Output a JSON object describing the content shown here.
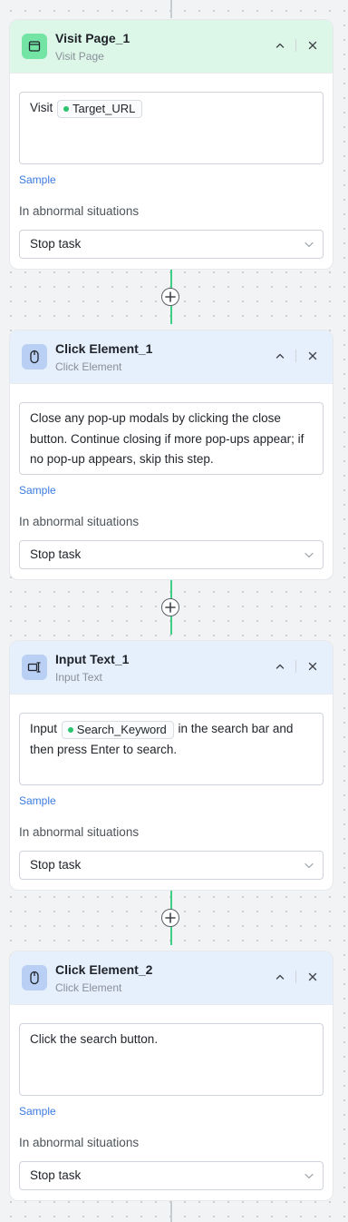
{
  "nodes": [
    {
      "title": "Visit Page_1",
      "subtitle": "Visit Page",
      "icon": "browser-window-icon",
      "header_color": "#dcf7e8",
      "prompt_parts": [
        {
          "type": "text",
          "text": "Visit "
        },
        {
          "type": "var",
          "text": "Target_URL"
        }
      ],
      "sample_label": "Sample",
      "abnormal_label": "In abnormal situations",
      "abnormal_value": "Stop task"
    },
    {
      "title": "Click Element_1",
      "subtitle": "Click Element",
      "icon": "mouse-icon",
      "header_color": "#e6effc",
      "prompt_parts": [
        {
          "type": "text",
          "text": "Close any pop-up modals by clicking the close button. Continue closing if more pop-ups appear; if no pop-up appears, skip this step."
        }
      ],
      "sample_label": "Sample",
      "abnormal_label": "In abnormal situations",
      "abnormal_value": "Stop task"
    },
    {
      "title": "Input Text_1",
      "subtitle": "Input Text",
      "icon": "text-input-icon",
      "header_color": "#e6effc",
      "prompt_parts": [
        {
          "type": "text",
          "text": "Input "
        },
        {
          "type": "var",
          "text": "Search_Keyword"
        },
        {
          "type": "text",
          "text": " in the search bar and then press Enter to search."
        }
      ],
      "sample_label": "Sample",
      "abnormal_label": "In abnormal situations",
      "abnormal_value": "Stop task"
    },
    {
      "title": "Click Element_2",
      "subtitle": "Click Element",
      "icon": "mouse-icon",
      "header_color": "#e6effc",
      "prompt_parts": [
        {
          "type": "text",
          "text": "Click the search button."
        }
      ],
      "sample_label": "Sample",
      "abnormal_label": "In abnormal situations",
      "abnormal_value": "Stop task"
    }
  ],
  "colors": {
    "connector_active": "#3ecf86",
    "connector_idle": "#c7ccd1",
    "link": "#3a7be0",
    "variable_dot": "#29c46c"
  }
}
